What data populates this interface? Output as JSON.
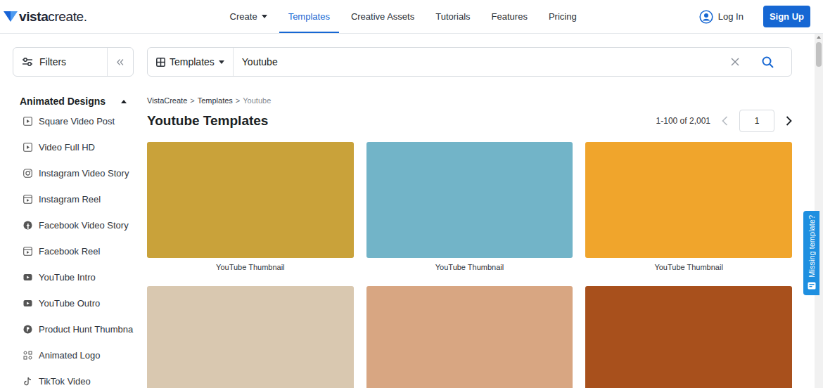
{
  "logo": {
    "bold": "vista",
    "light": "create."
  },
  "nav": [
    {
      "label": "Create",
      "dropdown": true,
      "selected": false
    },
    {
      "label": "Templates",
      "dropdown": false,
      "selected": true
    },
    {
      "label": "Creative Assets",
      "dropdown": false,
      "selected": false
    },
    {
      "label": "Tutorials",
      "dropdown": false,
      "selected": false
    },
    {
      "label": "Features",
      "dropdown": false,
      "selected": false
    },
    {
      "label": "Pricing",
      "dropdown": false,
      "selected": false
    }
  ],
  "auth": {
    "login": "Log In",
    "signup": "Sign Up"
  },
  "filters": {
    "label": "Filters"
  },
  "sidebar": {
    "section": {
      "title": "Animated Designs",
      "expanded": true
    },
    "items": [
      {
        "label": "Square Video Post",
        "kind": "video"
      },
      {
        "label": "Video Full HD",
        "kind": "video"
      },
      {
        "label": "Instagram Video Story",
        "kind": "instagram"
      },
      {
        "label": "Instagram Reel",
        "kind": "reel"
      },
      {
        "label": "Facebook Video Story",
        "kind": "facebook"
      },
      {
        "label": "Facebook Reel",
        "kind": "reel"
      },
      {
        "label": "YouTube Intro",
        "kind": "youtube"
      },
      {
        "label": "YouTube Outro",
        "kind": "youtube"
      },
      {
        "label": "Product Hunt Thumbna",
        "kind": "producthunt"
      },
      {
        "label": "Animated Logo",
        "kind": "logo"
      },
      {
        "label": "TikTok Video",
        "kind": "tiktok"
      }
    ]
  },
  "search": {
    "scope": "Templates",
    "query": "Youtube"
  },
  "breadcrumb": {
    "separator": ">",
    "items": [
      "VistaCreate",
      "Templates",
      "Youtube"
    ]
  },
  "title": "Youtube Templates",
  "pagination": {
    "range": "1-100 of 2,001",
    "page": "1",
    "prev_disabled": true,
    "next_disabled": false
  },
  "templates": [
    {
      "caption": "YouTube Thumbnail",
      "color": "#c9a23a"
    },
    {
      "caption": "YouTube Thumbnail",
      "color": "#72b4c8"
    },
    {
      "caption": "YouTube Thumbnail",
      "color": "#f0a52c"
    },
    {
      "color": "#d9c8b0"
    },
    {
      "color": "#d8a682"
    },
    {
      "color": "#a8501c"
    }
  ],
  "side_tab": {
    "label": "Missing template?"
  },
  "scrollbar": {
    "level": 0.07
  }
}
